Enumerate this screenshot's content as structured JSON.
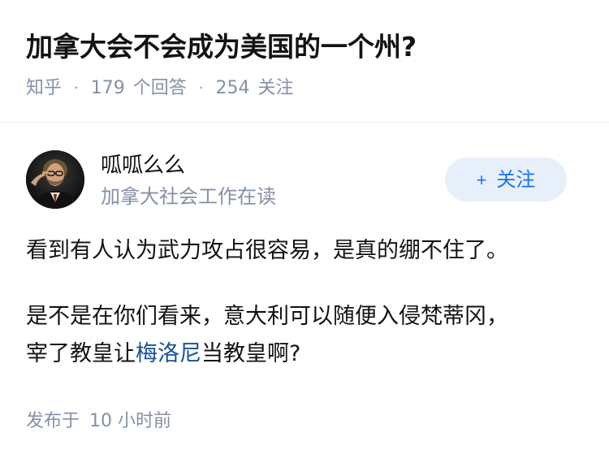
{
  "question": {
    "title": "加拿大会不会成为美国的一个州?",
    "source": "知乎",
    "answers_count": "179",
    "answers_label": "个回答",
    "followers_count": "254",
    "followers_label": "关注",
    "separator": "·"
  },
  "author": {
    "name": "呱呱么么",
    "bio": "加拿大社会工作在读",
    "follow_plus": "+",
    "follow_label": "关注",
    "avatar_icon": "portrait-avatar-icon"
  },
  "answer": {
    "paragraph1": "看到有人认为武力攻占很容易，是真的绷不住了。",
    "paragraph2_line1": "是不是在你们看来，意大利可以随便入侵梵蒂冈，",
    "paragraph2_line2_prefix": "宰了教皇让",
    "paragraph2_link": "梅洛尼",
    "paragraph2_line2_suffix": "当教皇啊?"
  },
  "footer": {
    "publish_label": "发布于",
    "publish_time": "10 小时前"
  },
  "colors": {
    "text_primary": "#121212",
    "text_secondary": "#8590a6",
    "link": "#175199",
    "follow_bg": "#e7f0fa",
    "follow_text": "#1772f6"
  }
}
